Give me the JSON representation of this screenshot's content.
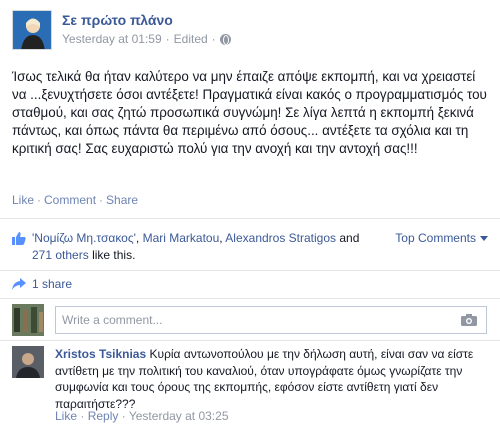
{
  "post": {
    "author": "Σε πρώτο πλάνο",
    "time": "Yesterday at 01:59",
    "edited": "Edited",
    "text": "Ίσως τελικά θα ήταν καλύτερο να μην έπαιζε απόψε εκπομπή, και να χρειαστεί να ...ξενυχτήσετε όσοι αντέξετε! Πραγματικά είναι κακός ο προγραμματισμός του σταθμού, και σας ζητώ προσωπικά συγνώμη! Σε λίγα λεπτά η εκπομπή ξεκινά πάντως, και όπως πάντα θα περιμένω από όσους... αντέξετε τα σχόλια και τη κριτική σας! Σας ευχαριστώ πολύ για την ανοχή και την αντοχή σας!!!"
  },
  "actions": {
    "like": "Like",
    "comment": "Comment",
    "share": "Share"
  },
  "likes": {
    "person1": "'Νομίζω Μη.τσακος'",
    "person2": "Mari Markatou",
    "person3": "Alexandros Stratigos",
    "and": "and",
    "others": "271 others",
    "suffix": "like this."
  },
  "top_comments": "Top Comments",
  "shares": "1 share",
  "write_comment": {
    "placeholder": "Write a comment..."
  },
  "comment": {
    "author": "Xristos Tsiknias",
    "text": "Κυρία αντωνοπούλου με την δήλωση αυτή, είναι σαν να είστε αντίθετη με την πολιτική του καναλιού, όταν υπογράφατε όμως γνωρίζατε την συμφωνία και τους όρους της εκπομπής, εφόσον είστε αντίθετη γιατί δεν παραιτήστε???",
    "like": "Like",
    "reply": "Reply",
    "time": "Yesterday at 03:25"
  },
  "colors": {
    "link": "#3b5998",
    "muted": "#9197a3",
    "action": "#6d84b4"
  },
  "icons": [
    "globe-icon",
    "like-thumb-icon",
    "share-icon",
    "camera-icon",
    "caret-down-icon"
  ]
}
